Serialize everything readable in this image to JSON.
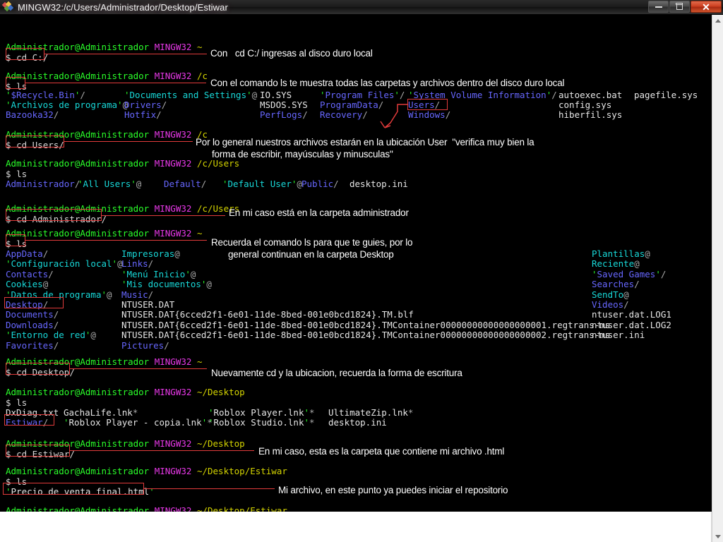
{
  "window": {
    "title": "MINGW32:/c/Users/Administrador/Desktop/Estiwar",
    "icon": "mingw-icon",
    "minimize_label": "Minimize",
    "maximize_label": "Maximize",
    "close_label": "Close",
    "close_glyph": "✕"
  },
  "colors": {
    "prompt_user": "#2aff2a",
    "prompt_host": "#e838e8",
    "prompt_path": "#d4d400",
    "directory": "#6767ff",
    "symlink": "#18d9d9",
    "file": "#e6e6e6",
    "quote": "#2aff2a",
    "annotation": "#ffffff",
    "highlight": "#e23b3b",
    "background": "#000000"
  },
  "terminal": {
    "user_host": "Administrador@Administrador",
    "shell": "MINGW32",
    "prompt_symbol": "$",
    "blocks": [
      {
        "path": "~",
        "command": "cd C:/",
        "note": "Con   cd C:/ ingresas al disco duro local"
      },
      {
        "path": "/c",
        "command": "ls",
        "note": "Con el comando ls te muestra todas las carpetas y archivos dentro del disco duro local",
        "listing_rows": [
          [
            "'$Recycle.Bin'/",
            "'Documents and Settings'@",
            "IO.SYS",
            "'Program Files'/",
            "'System Volume Information'/",
            "autoexec.bat",
            "pagefile.sys"
          ],
          [
            "'Archivos de programa'@",
            "Drivers/",
            "MSDOS.SYS",
            "ProgramData/",
            "Users/",
            "config.sys",
            ""
          ],
          [
            "Bazooka32/",
            "Hotfix/",
            "PerfLogs/",
            "Recovery/",
            "Windows/",
            "hiberfil.sys",
            ""
          ]
        ]
      },
      {
        "path": "/c",
        "command": "cd Users/",
        "note_line1": "Por lo general nuestros archivos estarán en la ubicación User  \"verifica muy bien la",
        "note_line2": "forma de escribir, mayúsculas y minusculas\""
      },
      {
        "path": "/c/Users",
        "command": "ls",
        "listing_rows": [
          [
            "Administrador/",
            "'All Users'@",
            "Default/",
            "'Default User'@",
            "Public/",
            "desktop.ini"
          ]
        ]
      },
      {
        "path": "/c/Users",
        "command": "cd Administrador/",
        "note": "En mi caso está en la carpeta administrador"
      },
      {
        "path": "~",
        "command": "ls",
        "note_line1": "Recuerda el comando ls para que te guies, por lo",
        "note_line2": "general continuan en la carpeta Desktop",
        "home_col1": [
          "AppData/",
          "'Configuración local'@",
          "Contacts/",
          "Cookies@",
          "'Datos de programa'@",
          "Desktop/",
          "Documents/",
          "Downloads/",
          "'Entorno de red'@",
          "Favorites/"
        ],
        "home_col2": [
          "Impresoras@",
          "Links/",
          "'Menú Inicio'@",
          "'Mis documentos'@",
          "Music/",
          "NTUSER.DAT",
          "NTUSER.DAT{6cced2f1-6e01-11de-8bed-001e0bcd1824}.TM.blf",
          "NTUSER.DAT{6cced2f1-6e01-11de-8bed-001e0bcd1824}.TMContainer00000000000000000001.regtrans-ms",
          "NTUSER.DAT{6cced2f1-6e01-11de-8bed-001e0bcd1824}.TMContainer00000000000000000002.regtrans-ms",
          "Pictures/"
        ],
        "home_col3": [
          "Plantillas@",
          "Reciente@",
          "'Saved Games'/",
          "Searches/",
          "SendTo@",
          "Videos/",
          "ntuser.dat.LOG1",
          "ntuser.dat.LOG2",
          "ntuser.ini"
        ]
      },
      {
        "path": "~",
        "command": "cd Desktop/",
        "note": "Nuevamente cd y la ubicacion, recuerda la forma de escritura"
      },
      {
        "path": "~/Desktop",
        "command": "ls",
        "listing_rows": [
          [
            "DxDiag.txt",
            "GachaLife.lnk*",
            "'Roblox Player.lnk'*",
            "UltimateZip.lnk*"
          ],
          [
            "Estiwar/",
            "'Roblox Player - copia.lnk'*",
            "'Roblox Studio.lnk'*",
            "desktop.ini"
          ]
        ]
      },
      {
        "path": "~/Desktop",
        "command": "cd Estiwar/",
        "note": "En mi caso, esta es la carpeta que contiene mi archivo .html"
      },
      {
        "path": "~/Desktop/Estiwar",
        "command": "ls",
        "result": "'Precio de venta final.html'",
        "note": "Mi archivo, en este punto ya puedes iniciar el repositorio"
      },
      {
        "path": "~/Desktop/Estiwar",
        "command": "",
        "cursor": true
      }
    ]
  },
  "scrollbar": {
    "up_arrow": "scroll-up",
    "down_arrow": "scroll-down",
    "thumb": "scroll-thumb"
  }
}
